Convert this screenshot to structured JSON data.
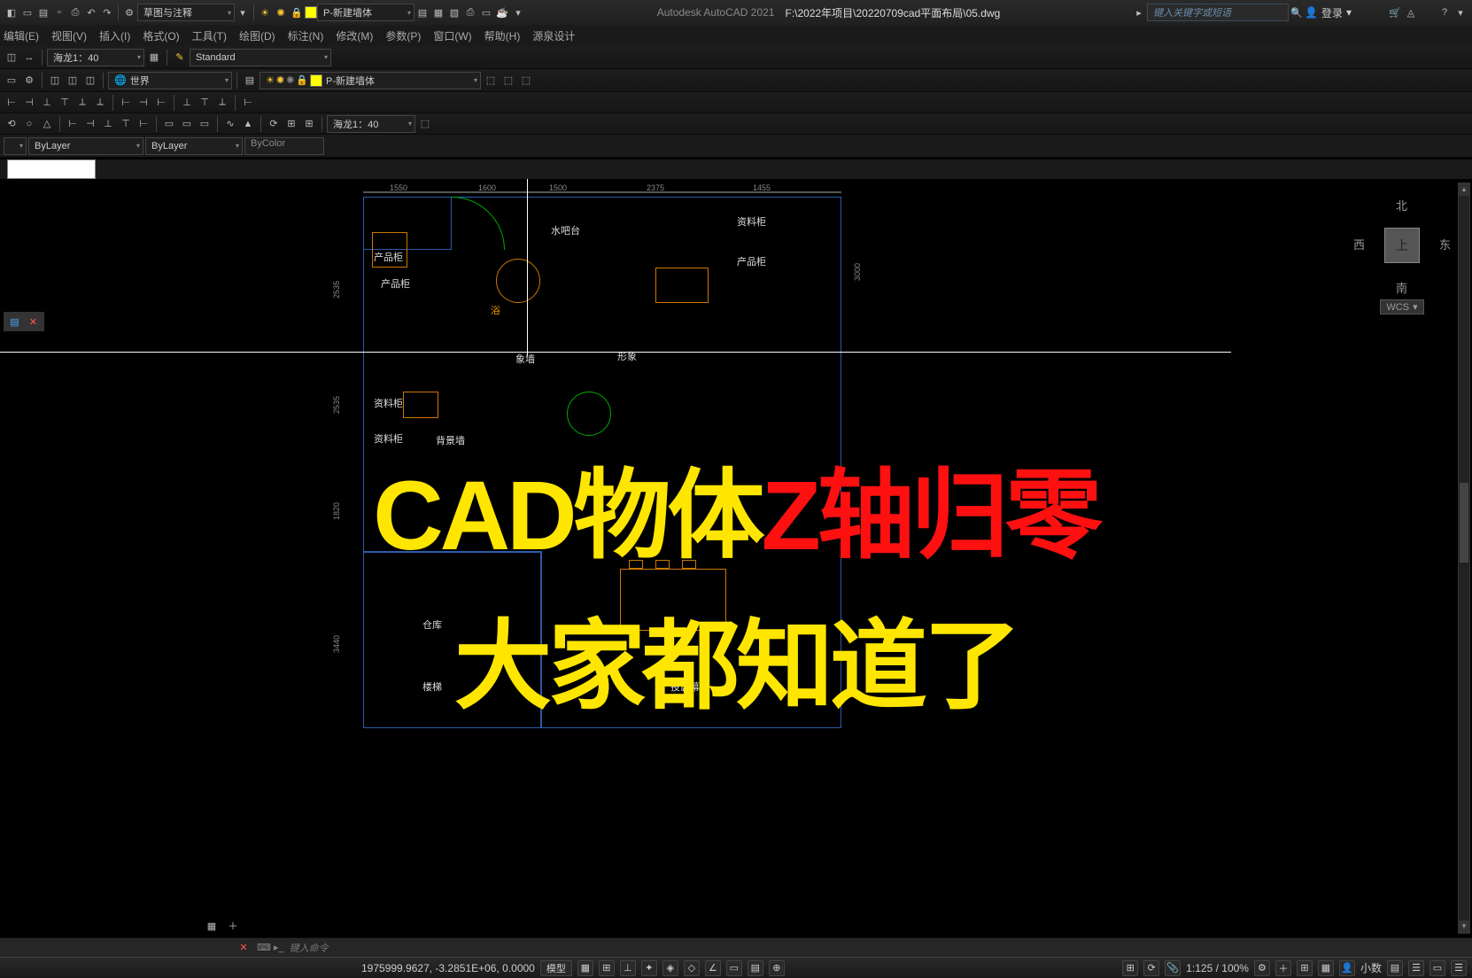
{
  "title": {
    "app": "Autodesk AutoCAD 2021",
    "file": "F:\\2022年项目\\20220709cad平面布局\\05.dwg",
    "search_placeholder": "键入关键字或短语",
    "login": "登录"
  },
  "quick": {
    "workspace": "草图与注释",
    "layer_current": "P-新建墙体"
  },
  "menu": [
    "编辑(E)",
    "视图(V)",
    "插入(I)",
    "格式(O)",
    "工具(T)",
    "绘图(D)",
    "标注(N)",
    "修改(M)",
    "参数(P)",
    "窗口(W)",
    "帮助(H)",
    "源泉设计"
  ],
  "toolbar_a": {
    "scale1": "海龙1：40",
    "style": "Standard",
    "ucs": "世界",
    "layer": "P-新建墙体",
    "scale2": "海龙1：40",
    "bylayer1": "ByLayer",
    "bylayer2": "ByLayer",
    "bycolor": "ByColor"
  },
  "plan": {
    "dims_top": [
      "1550",
      "1600",
      "1500",
      "2375",
      "1455"
    ],
    "dims_side": [
      "2535",
      "2535",
      "1820",
      "3440"
    ],
    "dim_right": "3000",
    "labels": {
      "水吧台": "水吧台",
      "资料柜1": "资料柜",
      "产品柜1": "产品柜",
      "产品柜2": "产品柜",
      "产品柜3": "产品柜",
      "浴": "浴",
      "象墙": "象墙",
      "形象": "形象",
      "资料柜2": "资料柜",
      "资料柜3": "资料柜",
      "背景墙": "背景墙",
      "仓库": "仓库",
      "楼梯": "楼梯",
      "投影幕": "投影幕"
    }
  },
  "overlay": {
    "l1a": "CAD物体",
    "l1b": "Z轴归零",
    "l2": "大家都知道了"
  },
  "viewcube": {
    "n": "北",
    "s": "南",
    "e": "东",
    "w": "西",
    "face": "上",
    "wcs": "WCS"
  },
  "cmd": {
    "prompt": "键入命令"
  },
  "status": {
    "coords": "1975999.9627, -3.2851E+06, 0.0000",
    "space": "模型",
    "scale": "1:125 / 100%",
    "decimal": "小数",
    "menu": "▾"
  }
}
